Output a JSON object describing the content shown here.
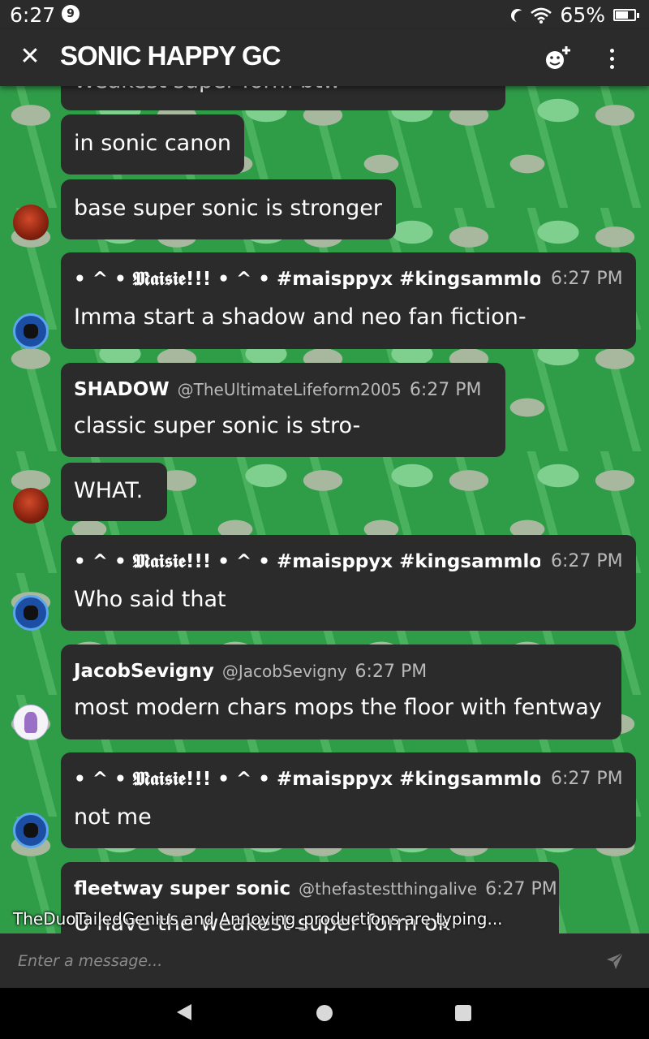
{
  "status_bar": {
    "time": "6:27",
    "notification_count": "9",
    "battery": "65%",
    "icons": [
      "moon-icon",
      "wifi-icon",
      "battery-icon"
    ]
  },
  "header": {
    "title": "SONIC HAPPY GC",
    "close_icon": "✕",
    "add_member_icon": "add-member-icon",
    "menu_icon": "more-vert-icon"
  },
  "messages": [
    {
      "text": "Weakest super form btw"
    },
    {
      "text": "in sonic canon"
    },
    {
      "text": "base super sonic is stronger"
    },
    {
      "author": "• ^ • 𝕸𝖆𝖎𝖘𝖎𝖊!!! • ^ • #maisppyx #kingsammlothar",
      "time": "6:27 PM",
      "text": "Imma start a shadow and neo fan fiction-"
    },
    {
      "author": "SHADOW",
      "handle": "@TheUltimateLifeform2005",
      "time": "6:27 PM",
      "text": "classic super sonic is stro-"
    },
    {
      "text": "WHAT."
    },
    {
      "author": "• ^ • 𝕸𝖆𝖎𝖘𝖎𝖊!!! • ^ • #maisppyx #kingsammlothar",
      "time": "6:27 PM",
      "text": "Who said that"
    },
    {
      "author": "JacobSevigny",
      "handle": "@JacobSevigny",
      "time": "6:27 PM",
      "text": "most modern chars mops the floor with fentway"
    },
    {
      "author": "• ^ • 𝕸𝖆𝖎𝖘𝖎𝖊!!! • ^ • #maisppyx #kingsammlothar",
      "time": "6:27 PM",
      "text": "not me"
    },
    {
      "author": "fleetway super sonic",
      "handle": "@thefastestthingalive",
      "time": "6:27 PM",
      "text": "U have the weakest super form ok"
    }
  ],
  "typing_indicator": "TheDuoTailedGenius and Annoying_productions are typing...",
  "composer": {
    "placeholder": "Enter a message...",
    "send_icon": "send-icon"
  },
  "nav_bar": {
    "icons": [
      "back-icon",
      "home-icon",
      "recents-icon"
    ]
  }
}
